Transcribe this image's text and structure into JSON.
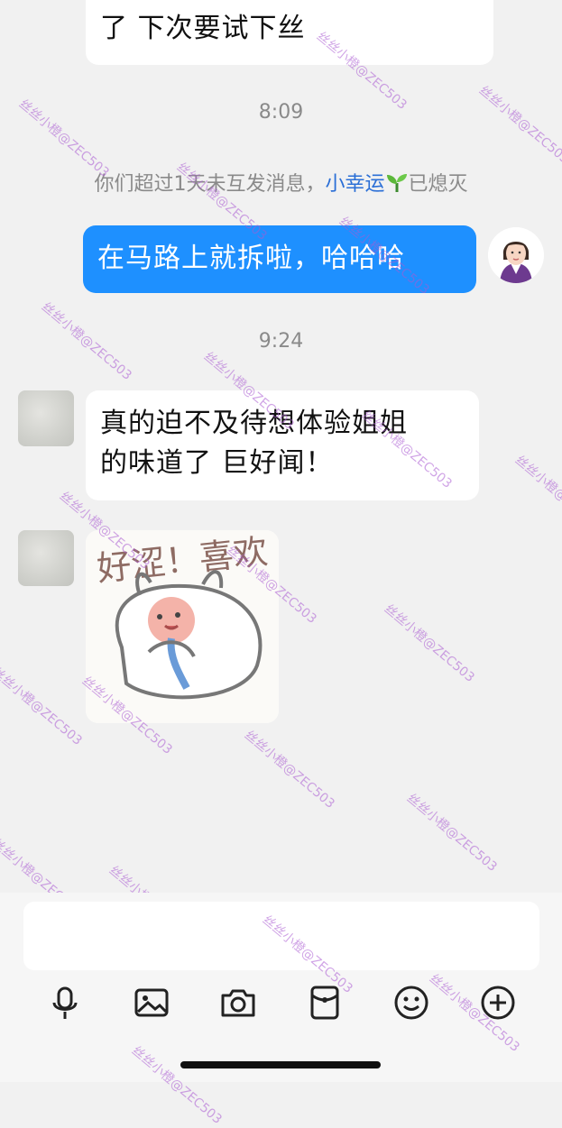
{
  "messages": [
    {
      "text_line1": "了  下次要试下丝"
    },
    {
      "time": "8:09"
    },
    {
      "notice_prefix": "你们超过1天未互发消息，",
      "notice_name": "小幸运",
      "notice_suffix": "已熄灭"
    },
    {
      "text": "在马路上就拆啦，哈哈哈"
    },
    {
      "time": "9:24"
    },
    {
      "text_line1": "真的迫不及待想体验姐姐",
      "text_line2": "的味道了  巨好闻！"
    }
  ],
  "sticker": {
    "text": "好涩！喜欢"
  },
  "watermark": "丝丝小橙@ZEC503",
  "toolbar": {
    "icons": [
      "microphone-icon",
      "image-icon",
      "camera-icon",
      "red-packet-icon",
      "emoji-icon",
      "plus-icon"
    ]
  },
  "colors": {
    "sent_bubble": "#1e90ff",
    "received_bubble": "#ffffff",
    "background": "#f1f1f1",
    "link": "#2b6fd6"
  }
}
